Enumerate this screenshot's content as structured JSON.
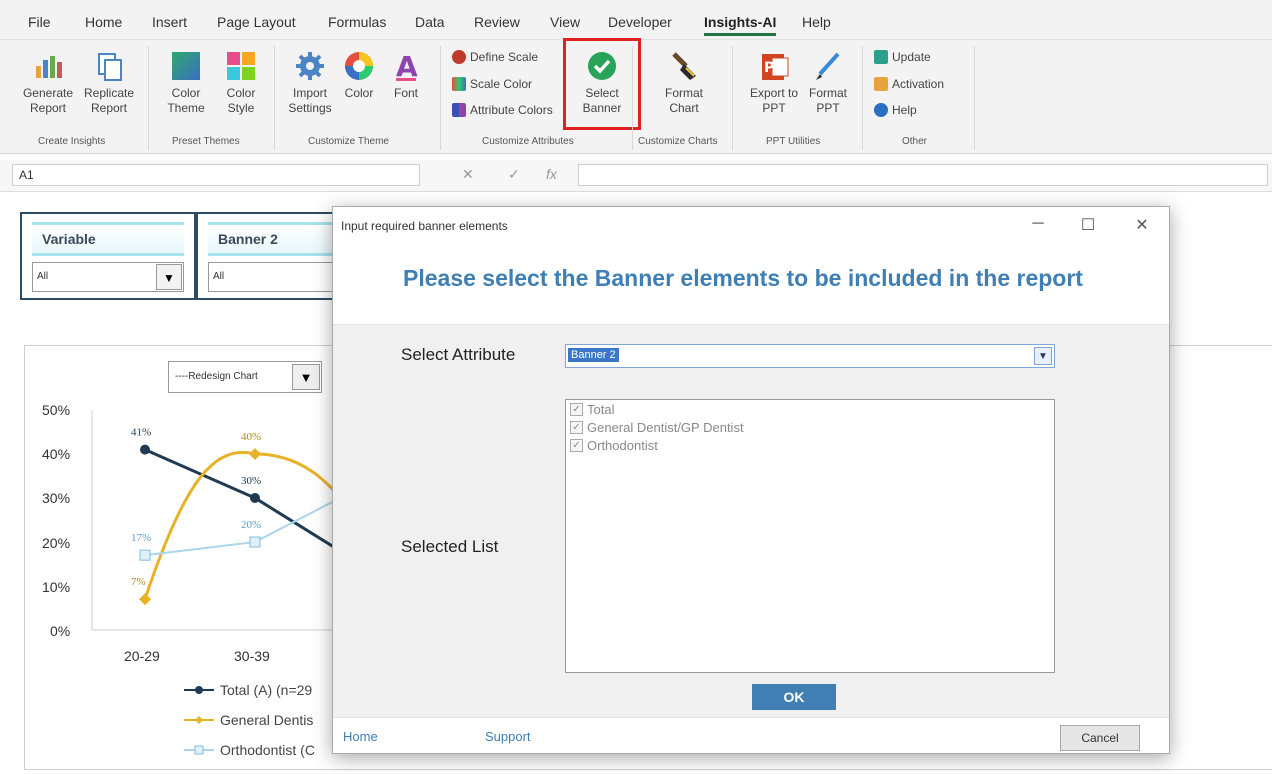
{
  "tabs": [
    "File",
    "Home",
    "Insert",
    "Page Layout",
    "Formulas",
    "Data",
    "Review",
    "View",
    "Developer",
    "Insights-AI",
    "Help"
  ],
  "active_tab": "Insights-AI",
  "ribbon": {
    "create": {
      "generate": "Generate Report",
      "replicate": "Replicate Report",
      "label": "Create Insights"
    },
    "preset": {
      "color_theme": "Color Theme",
      "color_style": "Color Style",
      "label": "Preset Themes"
    },
    "customize_theme": {
      "import": "Import Settings",
      "color": "Color",
      "font": "Font",
      "label": "Customize Theme"
    },
    "customize_attributes": {
      "define_scale": "Define Scale",
      "scale_color": "Scale Color",
      "attribute_colors": "Attribute Colors",
      "select_banner": "Select Banner",
      "label": "Customize Attributes"
    },
    "customize_charts": {
      "format_chart": "Format Chart",
      "label": "Customize Charts"
    },
    "ppt": {
      "export": "Export to PPT",
      "format": "Format PPT",
      "label": "PPT Utilities"
    },
    "other": {
      "update": "Update",
      "activation": "Activation",
      "help": "Help",
      "label": "Other"
    }
  },
  "formula_bar": {
    "cell_ref": "A1",
    "value": ""
  },
  "filters": [
    {
      "title": "Variable",
      "value": "All"
    },
    {
      "title": "Banner 2",
      "value": "All"
    }
  ],
  "chart": {
    "redesign_label": "----Redesign Chart",
    "ylabels": [
      "50%",
      "40%",
      "30%",
      "20%",
      "10%",
      "0%"
    ],
    "xlabels": [
      "20-29",
      "30-39"
    ],
    "legend": [
      "Total (A) (n=29",
      "General Dentis",
      "Orthodontist (C"
    ],
    "colors": {
      "total": "#1f3b53",
      "gp": "#e8b228",
      "ortho": "#a9d6ec"
    }
  },
  "chart_data": {
    "type": "line",
    "categories": [
      "20-29",
      "30-39"
    ],
    "ylim": [
      0,
      50
    ],
    "series": [
      {
        "name": "Total (A) (n=29",
        "values": [
          41,
          30
        ]
      },
      {
        "name": "General Dentis",
        "values": [
          7,
          40
        ]
      },
      {
        "name": "Orthodontist (C",
        "values": [
          17,
          20
        ]
      }
    ],
    "data_labels": {
      "total": [
        "41%",
        "30%"
      ],
      "gp": [
        "7%",
        "40%"
      ],
      "ortho": [
        "17%",
        "20%"
      ]
    }
  },
  "dialog": {
    "title": "Input required banner elements",
    "heading": "Please select the Banner elements to be included in the report",
    "select_attribute_label": "Select Attribute",
    "attribute_value": "Banner 2",
    "selected_list_label": "Selected List",
    "items": [
      "Total",
      "General Dentist/GP Dentist",
      "Orthodontist"
    ],
    "ok": "OK",
    "home": "Home",
    "support": "Support",
    "cancel": "Cancel"
  }
}
